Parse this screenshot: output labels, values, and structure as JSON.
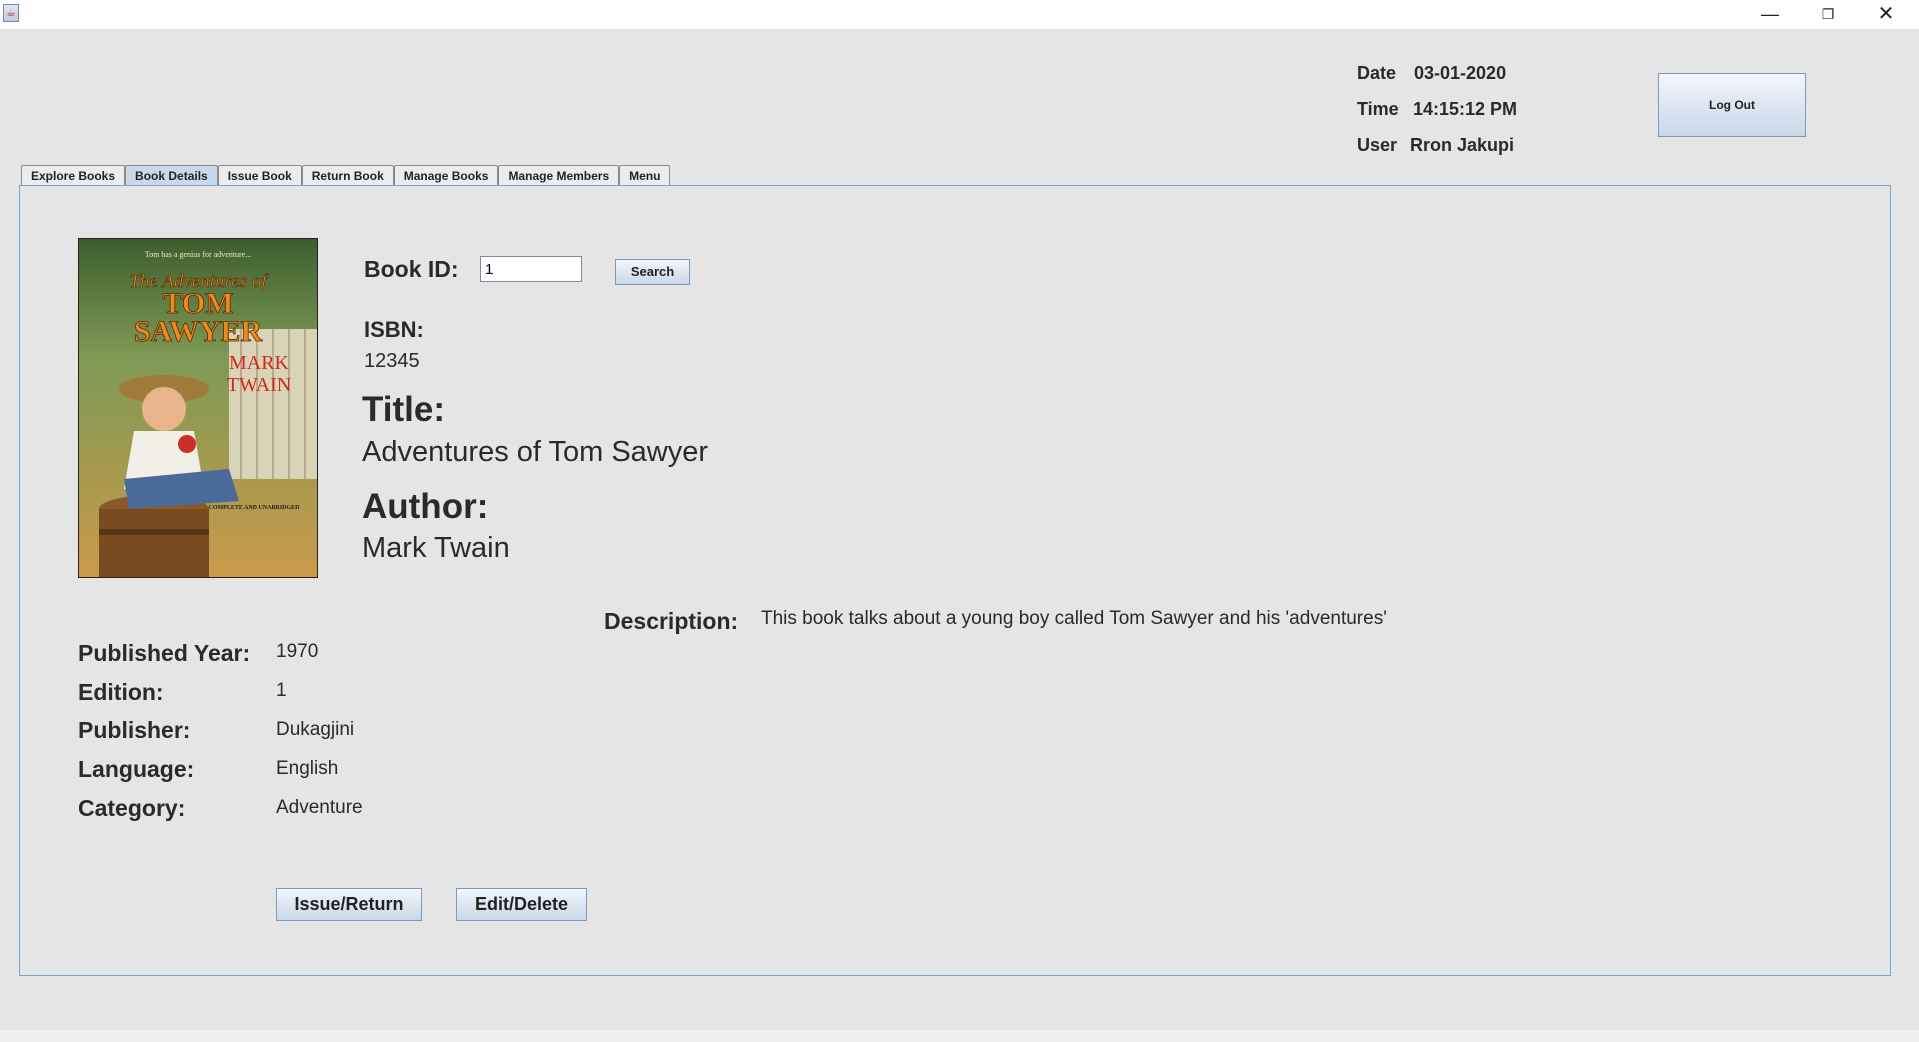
{
  "window": {
    "minimize": "—",
    "maximize": "❐",
    "close": "✕"
  },
  "header": {
    "date_label": "Date",
    "date_value": "03-01-2020",
    "time_label": "Time",
    "time_value": "14:15:12 PM",
    "user_label": "User",
    "user_value": "Rron Jakupi",
    "logout_label": "Log Out"
  },
  "tabs": [
    {
      "label": "Explore Books"
    },
    {
      "label": "Book Details",
      "active": true
    },
    {
      "label": "Issue Book"
    },
    {
      "label": "Return Book"
    },
    {
      "label": "Manage Books"
    },
    {
      "label": "Manage Members"
    },
    {
      "label": "Menu"
    }
  ],
  "book": {
    "cover_tagline": "Tom has a genius for adventure...",
    "cover_title_1": "The Adventures of",
    "cover_title_2": "TOM",
    "cover_title_3": "SAWYER",
    "cover_author_1": "MARK",
    "cover_author_2": "TWAIN",
    "cover_note": "COMPLETE AND UNABRIDGED",
    "book_id_label": "Book ID:",
    "book_id_value": "1",
    "search_label": "Search",
    "isbn_label": "ISBN:",
    "isbn_value": "12345",
    "title_label": "Title:",
    "title_value": "Adventures of Tom Sawyer",
    "author_label": "Author:",
    "author_value": "Mark Twain",
    "description_label": "Description:",
    "description_value": "This book talks about a young boy called Tom Sawyer and his 'adventures'",
    "published_year_label": "Published Year:",
    "published_year_value": "1970",
    "edition_label": "Edition:",
    "edition_value": "1",
    "publisher_label": "Publisher:",
    "publisher_value": "Dukagjini",
    "language_label": "Language:",
    "language_value": "English",
    "category_label": "Category:",
    "category_value": "Adventure"
  },
  "actions": {
    "issue_return": "Issue/Return",
    "edit_delete": "Edit/Delete"
  },
  "colors": {
    "background": "#e5e5e5",
    "panel_border": "#7da2c8",
    "active_tab": "#c9d9ec"
  }
}
